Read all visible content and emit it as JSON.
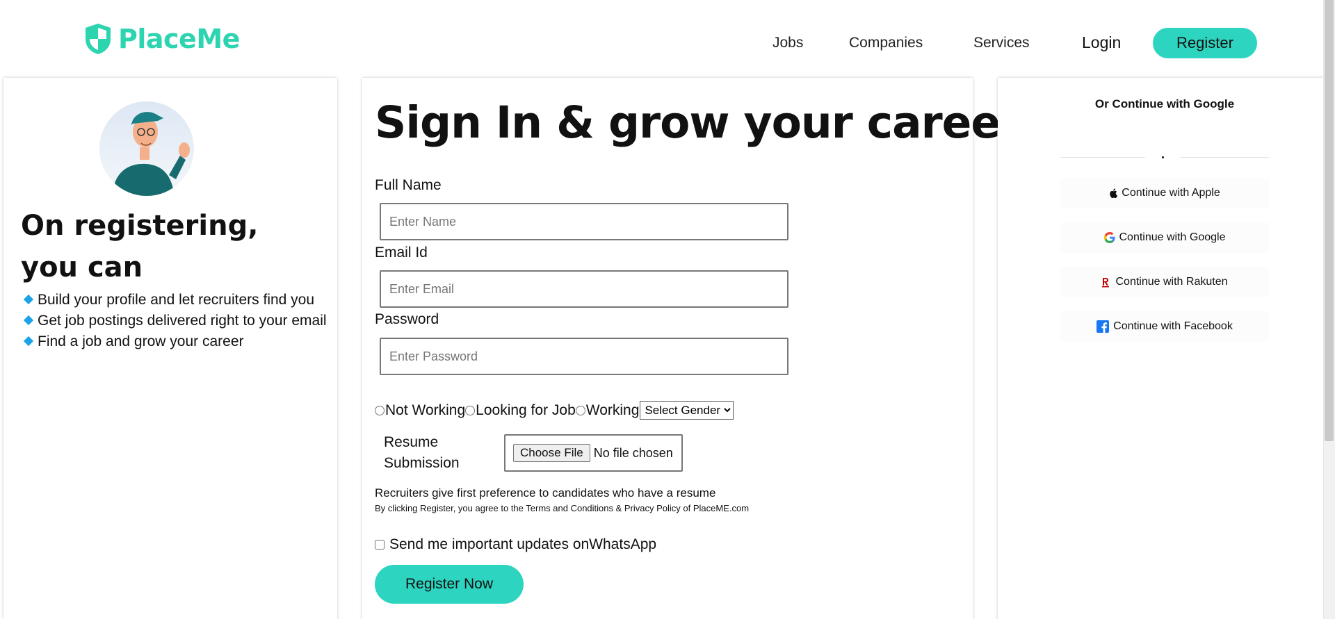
{
  "header": {
    "brand": "PlaceMe",
    "nav": [
      "Jobs",
      "Companies",
      "Services"
    ],
    "login_label": "Login",
    "register_label": "Register"
  },
  "left": {
    "title": "On registering, you can",
    "benefits": [
      "Build your profile and let recruiters find you",
      "Get job postings delivered right to your email",
      "Find a job and grow your career"
    ]
  },
  "form": {
    "title": "Sign In & grow your career",
    "name_label": "Full Name",
    "name_placeholder": "Enter Name",
    "email_label": "Email Id",
    "email_placeholder": "Enter Email",
    "password_label": "Password",
    "password_placeholder": "Enter Password",
    "status_options": [
      "Not Working",
      "Looking for Job",
      "Working"
    ],
    "gender_selected": "Select Gender",
    "resume_label": "Resume Submission",
    "file_button": "Choose File",
    "file_status": "No file chosen",
    "resume_note": "Recruiters give first preference to candidates who have a resume",
    "terms_note": "By clicking Register, you agree to the Terms and Conditions & Privacy Policy of PlaceME.com",
    "whatsapp_label": "Send me important updates onWhatsApp",
    "submit_label": "Register Now"
  },
  "social": {
    "title": "Or Continue with Google",
    "buttons": [
      {
        "label": "Continue with Apple",
        "icon": "apple-icon"
      },
      {
        "label": "Continue with Google",
        "icon": "google-icon"
      },
      {
        "label": "Continue with Rakuten",
        "icon": "rakuten-icon"
      },
      {
        "label": "Continue with Facebook",
        "icon": "facebook-icon"
      }
    ]
  },
  "colors": {
    "accent": "#2dd4bf",
    "brand_text": "#2dd4b0",
    "bullet": "#1aa3e8",
    "facebook": "#1877f2",
    "rakuten": "#bf0000"
  }
}
